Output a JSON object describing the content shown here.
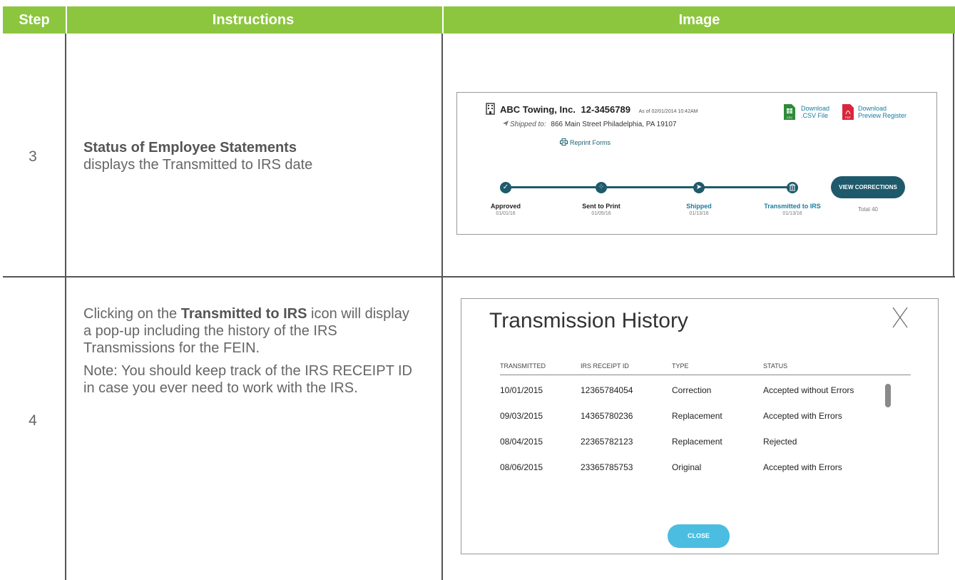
{
  "header": {
    "step": "Step",
    "instructions": "Instructions",
    "image": "Image"
  },
  "rows": [
    {
      "step": "3",
      "instr_bold": "Status of Employee Statements",
      "instr_text": "displays the Transmitted to IRS date"
    },
    {
      "step": "4",
      "instr_pre": "Clicking on the",
      "instr_bold": "Transmitted to IRS",
      "instr_post": "icon will display a pop-up including the history of the IRS Transmissions for the FEIN.",
      "note": "Note: You should keep track of the IRS RECEIPT ID in case you ever need to work with the IRS."
    }
  ],
  "card": {
    "company": "ABC Towing, Inc.",
    "fein": "12-3456789",
    "as_of": "As of 02/01/2014 10:42AM",
    "shipped_label": "Shipped to:",
    "address": "866 Main Street Philadelphia, PA 19107",
    "reprint": "Reprint Forms",
    "csv_line1": "Download",
    "csv_line2": ".CSV File",
    "csv_badge": "CSV",
    "pdf_line1": "Download",
    "pdf_line2": "Preview Register",
    "pdf_badge": "PDF",
    "steps": [
      {
        "label": "Approved",
        "date": "01/01/16"
      },
      {
        "label": "Sent to Print",
        "date": "01/05/16"
      },
      {
        "label": "Shipped",
        "date": "01/13/16"
      },
      {
        "label": "Transmitted to IRS",
        "date": "01/13/16"
      }
    ],
    "view_corrections": "VIEW CORRECTIONS",
    "total": "Total 40",
    "colors": {
      "accent": "#1e5a6b",
      "link": "#1a7ca0",
      "csv": "#2e8b3a",
      "pdf": "#d9263c"
    }
  },
  "modal": {
    "title": "Transmission History",
    "columns": [
      "TRANSMITTED",
      "IRS RECEIPT ID",
      "TYPE",
      "STATUS"
    ],
    "rows": [
      [
        "10/01/2015",
        "12365784054",
        "Correction",
        "Accepted without Errors"
      ],
      [
        "09/03/2015",
        "14365780236",
        "Replacement",
        "Accepted with Errors"
      ],
      [
        "08/04/2015",
        "22365782123",
        "Replacement",
        "Rejected"
      ],
      [
        "08/06/2015",
        "23365785753",
        "Original",
        "Accepted with Errors"
      ]
    ],
    "close": "CLOSE"
  }
}
